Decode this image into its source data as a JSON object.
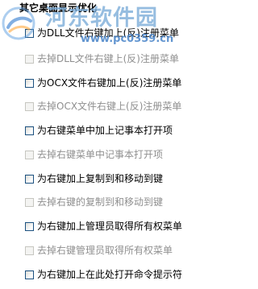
{
  "section": {
    "title": "其它桌面显示优化"
  },
  "options": [
    {
      "label": "为DLL文件右键加上(反)注册菜单",
      "enabled": true
    },
    {
      "label": "去掉DLL文件右键上(反)注册菜单",
      "enabled": false
    },
    {
      "label": "为OCX文件右键加上(反)注册菜单",
      "enabled": true
    },
    {
      "label": "去掉OCX文件右键上(反)注册菜单",
      "enabled": false
    },
    {
      "label": "为右键菜单中加上记事本打开项",
      "enabled": true
    },
    {
      "label": "去掉右键菜单中记事本打开项",
      "enabled": false
    },
    {
      "label": "为右键加上复制到和移动到键",
      "enabled": true
    },
    {
      "label": "去掉右键的复制到和移动到键",
      "enabled": false
    },
    {
      "label": "为右键加上管理员取得所有权菜单",
      "enabled": true
    },
    {
      "label": "去掉右键管理员取得所有权菜单",
      "enabled": false
    },
    {
      "label": "为右键加上在此处打开命令提示符",
      "enabled": true
    }
  ],
  "watermark": {
    "site_name": "河东软件园",
    "url": "www.pc0359.cn"
  },
  "colors": {
    "checkbox_border": "#1c5180",
    "disabled_text": "#8f8f8f",
    "watermark_blue": "#4682c8"
  }
}
